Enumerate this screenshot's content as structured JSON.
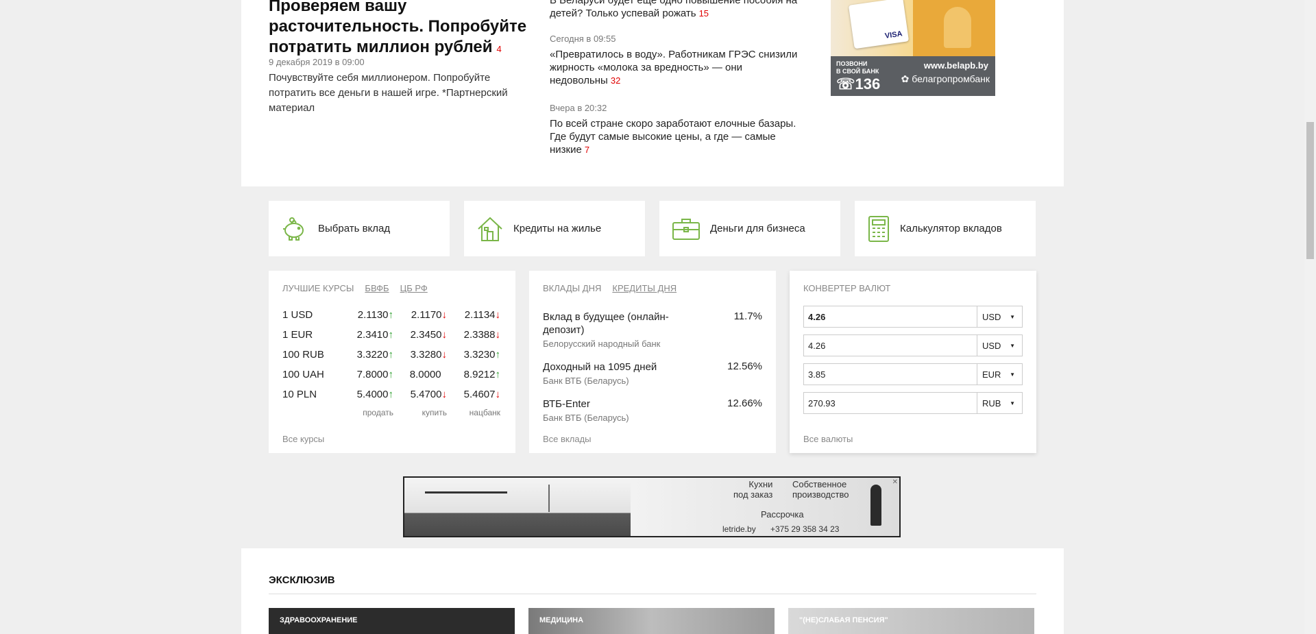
{
  "top_article": {
    "title": "Проверяем вашу расточительность. Попробуйте потратить миллион рублей",
    "comments": "4",
    "date": "9 декабря 2019 в 09:00",
    "lead": "Почувствуйте себя миллионером. Попробуйте потратить все деньги в нашей игре. *Партнерский материал"
  },
  "news": [
    {
      "time": "",
      "text": "В Беларуси будет еще одно повышение пособия на детей? Только успевай рожать",
      "comments": "15"
    },
    {
      "time": "Сегодня в 09:55",
      "text": "«Превратилось в воду». Работникам ГРЭС снизили жирность «молока за вредность» — они недовольны",
      "comments": "32"
    },
    {
      "time": "Вчера в 20:32",
      "text": "По всей стране скоро заработают елочные базары. Где будут самые высокие цены, а где — самые низкие",
      "comments": "7"
    }
  ],
  "ad_top": {
    "url": "www.belapb.by",
    "call1": "ПОЗВОНИ",
    "call2": "В СВОЙ БАНК",
    "phone": "136",
    "bank": "белагропромбанк",
    "card": "VISA"
  },
  "services": [
    {
      "label": "Выбрать вклад",
      "icon": "piggy-bank-icon"
    },
    {
      "label": "Кредиты на жилье",
      "icon": "house-icon"
    },
    {
      "label": "Деньги для бизнеса",
      "icon": "briefcase-icon"
    },
    {
      "label": "Калькулятор вкладов",
      "icon": "calculator-icon"
    }
  ],
  "rates": {
    "title": "ЛУЧШИЕ КУРСЫ",
    "tab1": "БВФБ",
    "tab2": "ЦБ РФ",
    "rows": [
      {
        "cur": "1 USD",
        "sell": "2.1130",
        "sell_dir": "up",
        "buy": "2.1170",
        "buy_dir": "down",
        "nb": "2.1134",
        "nb_dir": "down"
      },
      {
        "cur": "1 EUR",
        "sell": "2.3410",
        "sell_dir": "up",
        "buy": "2.3450",
        "buy_dir": "down",
        "nb": "2.3388",
        "nb_dir": "down"
      },
      {
        "cur": "100 RUB",
        "sell": "3.3220",
        "sell_dir": "up",
        "buy": "3.3280",
        "buy_dir": "down",
        "nb": "3.3230",
        "nb_dir": "up"
      },
      {
        "cur": "100 UAH",
        "sell": "7.8000",
        "sell_dir": "up",
        "buy": "8.0000",
        "buy_dir": "none",
        "nb": "8.9212",
        "nb_dir": "up"
      },
      {
        "cur": "10 PLN",
        "sell": "5.4000",
        "sell_dir": "up",
        "buy": "5.4700",
        "buy_dir": "down",
        "nb": "5.4607",
        "nb_dir": "down"
      }
    ],
    "col_sell": "продать",
    "col_buy": "купить",
    "col_nb": "нацбанк",
    "footer": "Все курсы"
  },
  "deposits": {
    "tab1": "ВКЛАДЫ ДНЯ",
    "tab2": "КРЕДИТЫ ДНЯ",
    "items": [
      {
        "name": "Вклад в будущее (онлайн-депозит)",
        "rate": "11.7%",
        "bank": "Белорусский народный банк"
      },
      {
        "name": "Доходный на 1095 дней",
        "rate": "12.56%",
        "bank": "Банк ВТБ (Беларусь)"
      },
      {
        "name": "ВТБ-Enter",
        "rate": "12.66%",
        "bank": "Банк ВТБ (Беларусь)"
      }
    ],
    "footer": "Все вклады"
  },
  "converter": {
    "title": "КОНВЕРТЕР ВАЛЮТ",
    "rows": [
      {
        "value": "4.26",
        "currency": "USD"
      },
      {
        "value": "4.26",
        "currency": "USD"
      },
      {
        "value": "3.85",
        "currency": "EUR"
      },
      {
        "value": "270.93",
        "currency": "RUB"
      }
    ],
    "footer": "Все валюты"
  },
  "ad_mid": {
    "line1": "Кухни",
    "line2": "под заказ",
    "line3": "Собственное",
    "line4": "производство",
    "line5": "Рассрочка",
    "site": "letride.by",
    "phone": "+375 29 358 34 23"
  },
  "exclusive": {
    "title": "ЭКСКЛЮЗИВ",
    "cards": [
      "ЗДРАВООХРАНЕНИЕ",
      "МЕДИЦИНА",
      "\"(НЕ)СЛАБАЯ ПЕНСИЯ\""
    ]
  }
}
